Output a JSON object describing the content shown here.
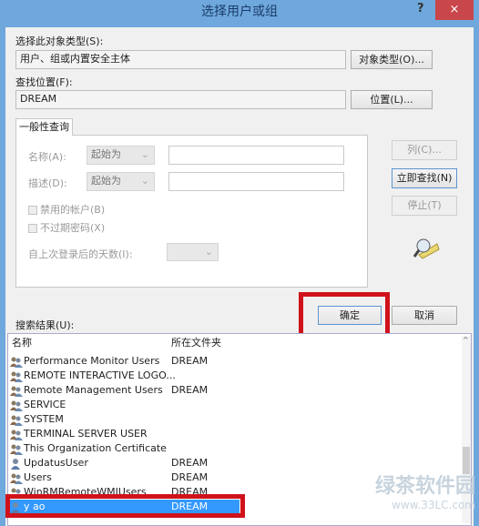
{
  "window": {
    "title": "选择用户或组",
    "help": "?",
    "close": "×"
  },
  "object_type": {
    "label": "选择此对象类型(S):",
    "value": "用户、组或内置安全主体",
    "button": "对象类型(O)..."
  },
  "location": {
    "label": "查找位置(F):",
    "value": "DREAM",
    "button": "位置(L)..."
  },
  "query": {
    "tab": "一般性查询",
    "name_label": "名称(A):",
    "name_mode": "起始为",
    "desc_label": "描述(D):",
    "desc_mode": "起始为",
    "disabled_accounts": "禁用的帐户(B)",
    "no_expire": "不过期密码(X)",
    "days_label": "自上次登录后的天数(I):",
    "days_value": ""
  },
  "side_buttons": {
    "columns": "列(C)...",
    "find_now": "立即查找(N)",
    "stop": "停止(T)"
  },
  "ok": "确定",
  "cancel": "取消",
  "results": {
    "label": "搜索结果(U):",
    "columns": [
      "名称",
      "所在文件夹"
    ],
    "rows": [
      {
        "name": "Performance Monitor Users",
        "folder": "DREAM",
        "icon": "group-icon"
      },
      {
        "name": "REMOTE INTERACTIVE LOGO...",
        "folder": "",
        "icon": "group-icon"
      },
      {
        "name": "Remote Management Users",
        "folder": "DREAM",
        "icon": "group-icon"
      },
      {
        "name": "SERVICE",
        "folder": "",
        "icon": "group-icon"
      },
      {
        "name": "SYSTEM",
        "folder": "",
        "icon": "group-icon"
      },
      {
        "name": "TERMINAL SERVER USER",
        "folder": "",
        "icon": "group-icon"
      },
      {
        "name": "This Organization Certificate",
        "folder": "",
        "icon": "group-icon"
      },
      {
        "name": "UpdatusUser",
        "folder": "DREAM",
        "icon": "user-icon"
      },
      {
        "name": "Users",
        "folder": "DREAM",
        "icon": "group-icon"
      },
      {
        "name": "WinRMRemoteWMIUsers__",
        "folder": "DREAM",
        "icon": "group-icon"
      },
      {
        "name": "y        ao",
        "folder": "DREAM",
        "icon": "user-icon",
        "selected": true
      }
    ]
  },
  "watermark": {
    "brand": "绿茶软件园",
    "url": "www.33LC.com"
  },
  "colors": {
    "selection": "#3399ff",
    "highlight": "#d0121b",
    "close": "#c9464b"
  }
}
